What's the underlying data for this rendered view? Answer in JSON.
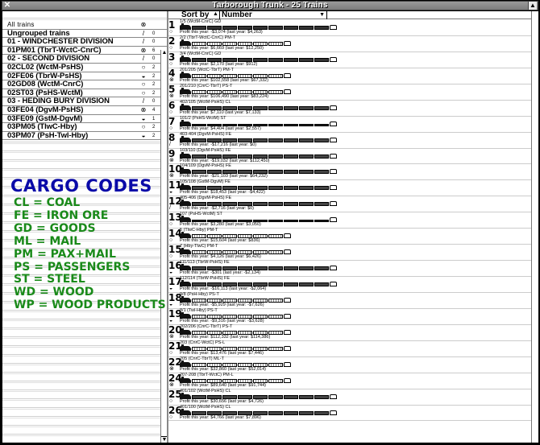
{
  "window": {
    "title": "Tarborough Trunk - 25 Trains",
    "close_icon": "close-icon",
    "minimize_icon": "minimize-icon"
  },
  "groups": [
    {
      "label": "All trains",
      "icon": "⊗",
      "icon_name": "mixed-status-icon",
      "count": ""
    },
    {
      "label": "Ungrouped trains",
      "icon": "/",
      "icon_name": "pencil-icon",
      "count": "0"
    },
    {
      "label": "01 - WINDCHESTER DIVISION",
      "icon": "/",
      "icon_name": "pencil-icon",
      "count": "0"
    },
    {
      "label": "01PM01 (TbrT-WctC-CnrC)",
      "icon": "⊗",
      "icon_name": "mixed-status-icon",
      "count": "6"
    },
    {
      "label": "02 - SECOND DIVISION",
      "icon": "/",
      "icon_name": "pencil-icon",
      "count": "0"
    },
    {
      "label": "02CL02 (WctM-PsHS)",
      "icon": "○",
      "icon_name": "empty-status-icon",
      "count": "2"
    },
    {
      "label": "02FE06 (TbrW-PsHS)",
      "icon": "◒",
      "icon_name": "half-status-icon",
      "count": "2"
    },
    {
      "label": "02GD08 (WctM-CnrC)",
      "icon": "○",
      "icon_name": "empty-status-icon",
      "count": "2"
    },
    {
      "label": "02ST03 (PsHS-WctM)",
      "icon": "○",
      "icon_name": "empty-status-icon",
      "count": "2"
    },
    {
      "label": "03 - HEDING BURY DIVISION",
      "icon": "/",
      "icon_name": "pencil-icon",
      "count": "0"
    },
    {
      "label": "03FE04 (DgvM-PsHS)",
      "icon": "⊗",
      "icon_name": "mixed-status-icon",
      "count": "4"
    },
    {
      "label": "03FE09 (GstM-DgvM)",
      "icon": "◒",
      "icon_name": "half-status-icon",
      "count": "1"
    },
    {
      "label": "03PM05 (TlwC-Hby)",
      "icon": "○",
      "icon_name": "empty-status-icon",
      "count": "2"
    },
    {
      "label": "03PM07 (PsH-Twl-Hby)",
      "icon": "◒",
      "icon_name": "half-status-icon",
      "count": "2"
    }
  ],
  "cargo_codes": {
    "title": "CARGO CODES",
    "items": [
      "CL = COAL",
      "FE = IRON ORE",
      "GD = GOODS",
      "ML = MAIL",
      "PM = PAX+MAIL",
      "PS = PASSENGERS",
      "ST = STEEL",
      "WD = WOOD",
      "WP = WOOD PRODUCTS"
    ],
    "title_color": "#0a0aa8",
    "item_color": "#1a8a1a"
  },
  "sort": {
    "label": "Sort by",
    "direction_icon": "▲",
    "value": "Number",
    "dropdown_icon": "▼"
  },
  "trains": [
    {
      "number": "1",
      "route": "1/5 (WctM-CnrC) GD",
      "status": "○",
      "profit": "Profit this year: -$3,074 (last year: $4,263)",
      "consist": "goods"
    },
    {
      "number": "2",
      "route": "2/2 (TbrT-WctC-CnrC) PM-T",
      "status": "○",
      "profit": "Profit this year: $6,669 (last year: $12,250)",
      "consist": "pass"
    },
    {
      "number": "3",
      "route": "3/4 (WctM-CnrC) GD",
      "status": "○",
      "profit": "Profit this year: $2,170 (last year: $912)",
      "consist": "goods"
    },
    {
      "number": "4",
      "route": "201/205 (WctC-TbrT) PM-T",
      "status": "⊗",
      "profit": "Profit this year: $102,558 (last year: $67,332)",
      "consist": "pass"
    },
    {
      "number": "5",
      "route": "201/210 (CnrC-TbrT) PS-T",
      "status": "⊗",
      "profit": "Profit this year: $106,490 (last year: $83,224)",
      "consist": "pass"
    },
    {
      "number": "6",
      "route": "402/105 (WctM-PsHS) CL",
      "status": "○",
      "profit": "Profit this year: $7,110 (last year: $7,133)",
      "consist": "coal"
    },
    {
      "number": "7",
      "route": "101/2 (PsHS-WctM) ST",
      "status": "○",
      "profit": "Profit this year: $4,404 (last year: $2,557)",
      "consist": "flat"
    },
    {
      "number": "8",
      "route": "403-404 (DgvM-PsHS) FE",
      "status": "/",
      "profit": "Profit this year: -$17,216 (last year: $0)",
      "consist": "ore"
    },
    {
      "number": "9",
      "route": "103/110 (DgvM-PsHS) FE",
      "status": "⊗",
      "profit": "Profit this year: -$19,032 (last year: $112,450)",
      "consist": "ore"
    },
    {
      "number": "10",
      "route": "104/109 (DgvM-PsHS) FE",
      "status": "⊗",
      "profit": "Profit this year: -$21,103 (last year: $64,232)",
      "consist": "ore"
    },
    {
      "number": "11",
      "route": "105/108 (GstM-DgvM) FE",
      "status": "◒",
      "profit": "Profit this year: $18,453 (last year: -$4,422)",
      "consist": "ore"
    },
    {
      "number": "12",
      "route": "405-406 (DgvM-PsHS) FE",
      "status": "/",
      "profit": "Profit this year: -$2,716 (last year: $0)",
      "consist": "ore"
    },
    {
      "number": "13",
      "route": "107 (PsHS-WctM) ST",
      "status": "○",
      "profit": "Profit this year: $3,280 (last year: $3,050)",
      "consist": "flat"
    },
    {
      "number": "14",
      "route": "5 (TlwC-Hby) PM-T",
      "status": "○",
      "profit": "Profit this year: $15,604 (last year: $836)",
      "consist": "pass"
    },
    {
      "number": "15",
      "route": "7 (Hby-TlwC) PM-T",
      "status": "○",
      "profit": "Profit this year: $4,126 (last year: $6,426)",
      "consist": "pass"
    },
    {
      "number": "16",
      "route": "111/113 (TbrW-PsHS) FE",
      "status": "◒",
      "profit": "Profit this year: -$301 (last year: -$2,134)",
      "consist": "ore"
    },
    {
      "number": "17",
      "route": "112/114 (TbrW-PsHS) FE",
      "status": "◒",
      "profit": "Profit this year: -$16,113 (last year: -$2,064)",
      "consist": "ore"
    },
    {
      "number": "18",
      "route": "9/8 (PsH-Hby) PS-T",
      "status": "◒",
      "profit": "Profit this year: -$5,929 (last year: -$7,626)",
      "consist": "pass"
    },
    {
      "number": "19",
      "route": "8/1 (Twl-Hby) PS-T",
      "status": "◒",
      "profit": "Profit this year: -$9,316 (last year: -$3,628)",
      "consist": "pass"
    },
    {
      "number": "20",
      "route": "202/206 (CnrC-TbrT) PS-T",
      "status": "⊗",
      "profit": "Profit this year: $112,332 (last year: $114,386)",
      "consist": "pass"
    },
    {
      "number": "21",
      "route": "203 (CnrC-WctC) PS-L",
      "status": "○",
      "profit": "Profit this year: $13,476 (last year: $7,446)",
      "consist": "pass"
    },
    {
      "number": "22",
      "route": "205 (CnrC-TbrT) ML-T",
      "status": "⊗",
      "profit": "Profit this year: $32,860 (last year: $52,014)",
      "consist": "pass"
    },
    {
      "number": "24",
      "route": "207-208 (TbrT-WctC) PM-L",
      "status": "⊗",
      "profit": "Profit this year: $89,640 (last year: $91,744)",
      "consist": "pass"
    },
    {
      "number": "25",
      "route": "401/102 (WctM-PsHS) CL",
      "status": "○",
      "profit": "Profit this year: $30,656 (last year: $4,726)",
      "consist": "coal"
    },
    {
      "number": "26",
      "route": "401/100 (WctM-PsHS) CL",
      "status": "○",
      "profit": "Profit this year: $4,766 (last year: $7,896)",
      "consist": "coal"
    }
  ]
}
